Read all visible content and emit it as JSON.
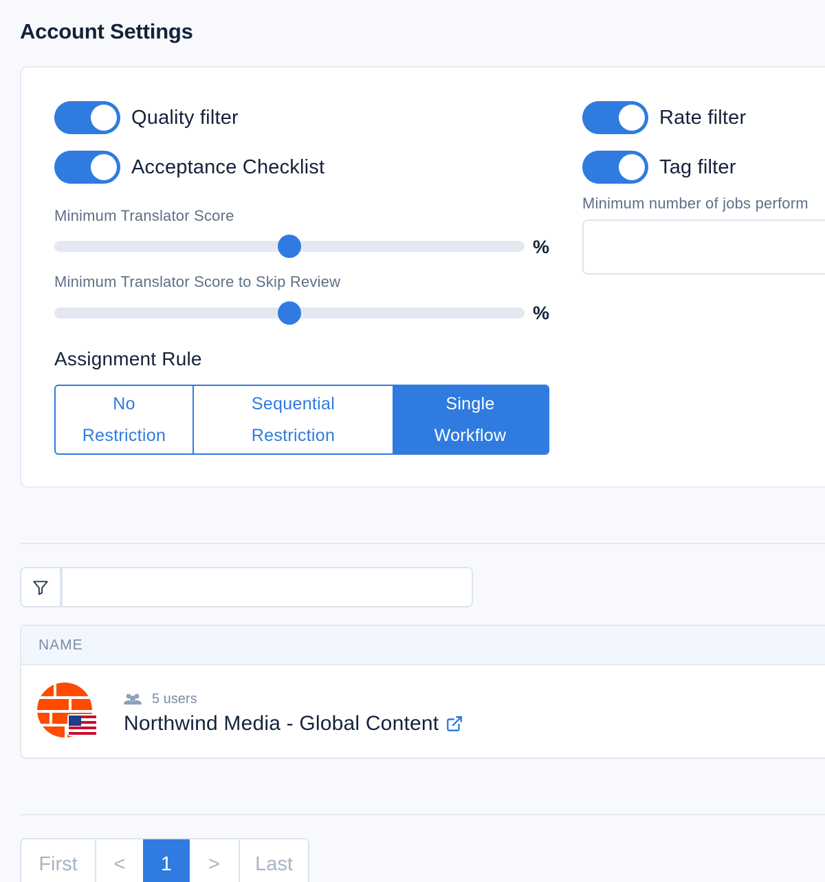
{
  "page": {
    "title": "Account Settings"
  },
  "toggles": {
    "quality_filter": {
      "label": "Quality filter",
      "on": true
    },
    "acceptance_checklist": {
      "label": "Acceptance Checklist",
      "on": true
    },
    "rate_filter": {
      "label": "Rate filter",
      "on": true
    },
    "tag_filter": {
      "label": "Tag filter",
      "on": true
    }
  },
  "sliders": {
    "min_translator_score": {
      "label": "Minimum Translator Score",
      "unit": "%",
      "value_percent": 50
    },
    "min_score_skip_review": {
      "label": "Minimum Translator Score to Skip Review",
      "unit": "%",
      "value_percent": 50
    }
  },
  "min_jobs": {
    "label": "Minimum number of jobs perform",
    "value": ""
  },
  "assignment_rule": {
    "label": "Assignment Rule",
    "options": [
      {
        "line1": "No",
        "line2": "Restriction"
      },
      {
        "line1": "Sequential",
        "line2": "Restriction"
      },
      {
        "line1": "Single",
        "line2": "Workflow"
      }
    ],
    "selected": "Single Workflow"
  },
  "filter": {
    "value": "",
    "icon": "filter-icon"
  },
  "table": {
    "header": "NAME",
    "rows": [
      {
        "users": "5 users",
        "name": "Northwind Media - Global Content",
        "flag": "us-flag-icon",
        "logo_color": "#ff4a00"
      }
    ]
  },
  "pagination": {
    "first": "First",
    "prev": "<",
    "current": "1",
    "next": ">",
    "last": "Last"
  },
  "colors": {
    "accent": "#2f7be0",
    "logo": "#ff4a00"
  }
}
